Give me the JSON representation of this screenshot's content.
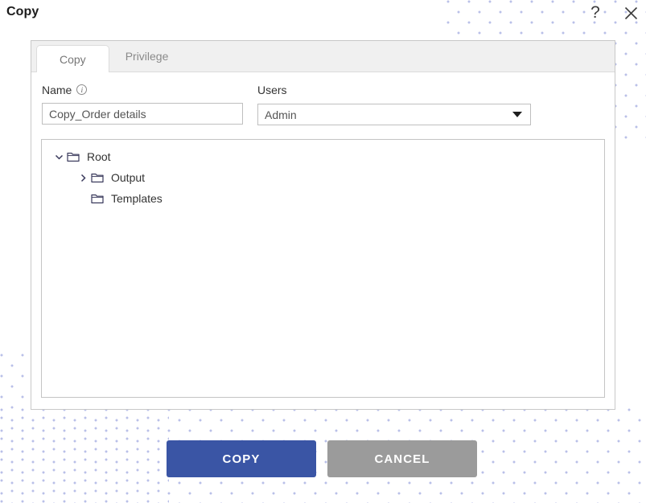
{
  "window": {
    "title": "Copy",
    "help_icon": "question-mark-icon",
    "close_icon": "close-icon"
  },
  "tabs": [
    {
      "label": "Copy",
      "active": true
    },
    {
      "label": "Privilege",
      "active": false
    }
  ],
  "form": {
    "name": {
      "label": "Name",
      "info_icon": "info-icon",
      "value": "Copy_Order details",
      "placeholder": "Name"
    },
    "users": {
      "label": "Users",
      "value": "Admin",
      "options": [
        "Admin"
      ],
      "caret_icon": "chevron-down-icon"
    }
  },
  "tree": {
    "nodes": [
      {
        "label": "Root",
        "depth": 0,
        "expanded": true,
        "has_children": true,
        "icon": "folder-icon"
      },
      {
        "label": "Output",
        "depth": 1,
        "expanded": false,
        "has_children": true,
        "icon": "folder-icon"
      },
      {
        "label": "Templates",
        "depth": 1,
        "expanded": false,
        "has_children": false,
        "icon": "folder-icon"
      }
    ]
  },
  "footer": {
    "copy_label": "COPY",
    "cancel_label": "CANCEL"
  },
  "colors": {
    "primary": "#3a55a5",
    "secondary": "#9b9b9b",
    "dot_pattern": "#b9c0e8",
    "tab_bar_bg": "#f0f0f0",
    "border": "#c8c8c8"
  }
}
